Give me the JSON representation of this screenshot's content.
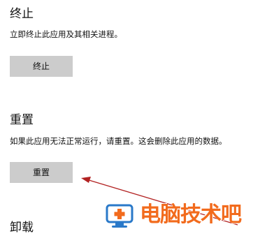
{
  "sections": {
    "terminate": {
      "title": "终止",
      "description": "立即终止此应用及其相关进程。",
      "button_label": "终止"
    },
    "reset": {
      "title": "重置",
      "description": "如果此应用无法正常运行，请重置。这会删除此应用的数据。",
      "button_label": "重置"
    },
    "uninstall": {
      "title": "卸载"
    }
  },
  "watermark": {
    "text": "电脑技术吧"
  },
  "colors": {
    "button_bg": "#cccccc",
    "annotation_arrow": "#b22222",
    "watermark": "#f26b1d",
    "watermark_icon": "#2a79c9"
  }
}
